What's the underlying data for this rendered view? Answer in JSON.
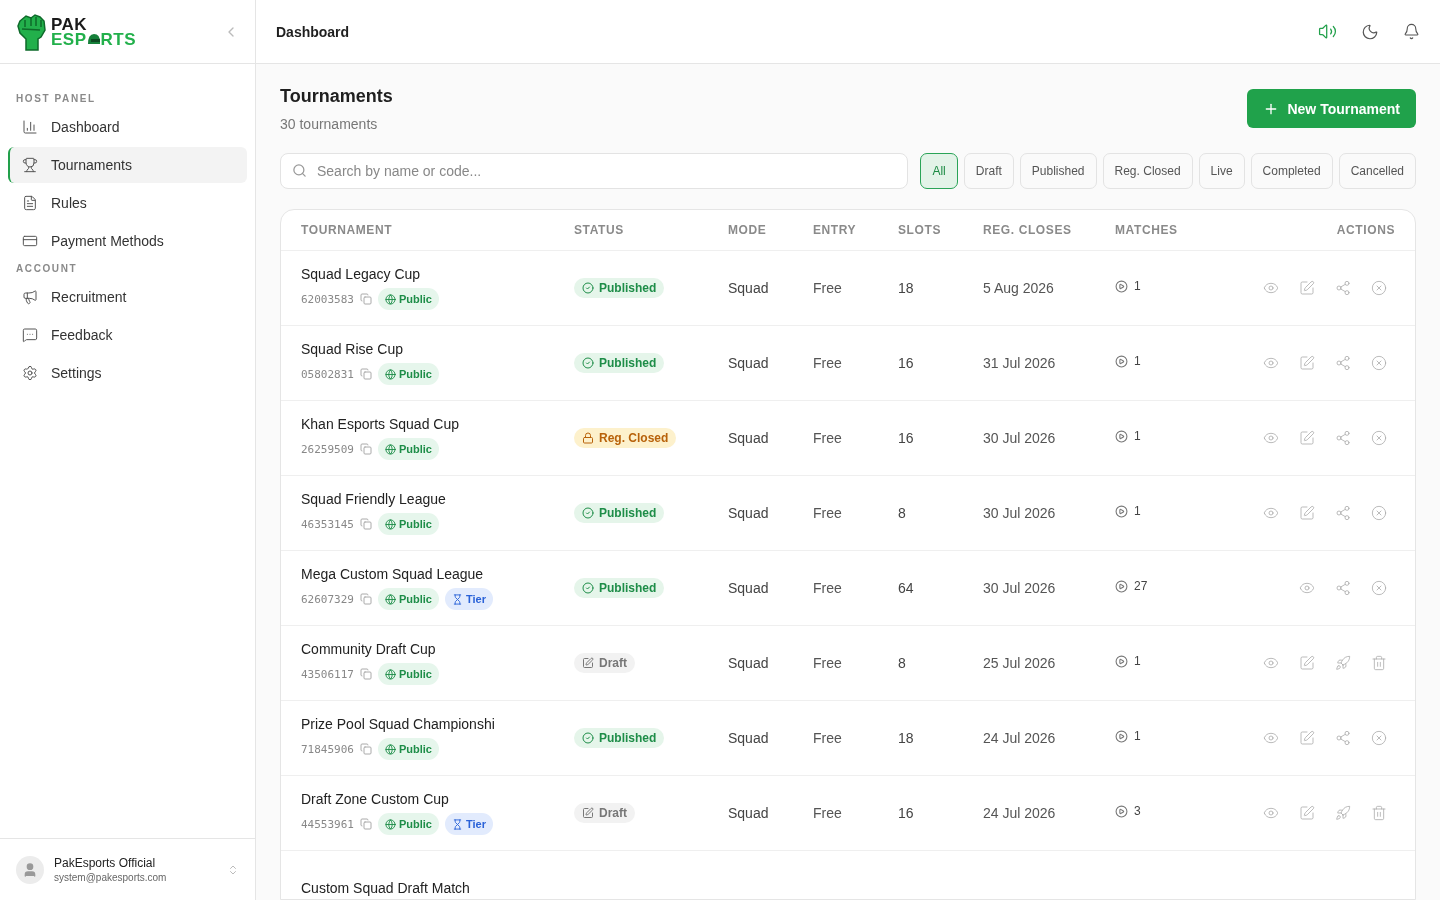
{
  "logo": {
    "line1": "PAK",
    "line2_start": "ESP",
    "line2_end": "RTS"
  },
  "sidebar": {
    "sections": [
      {
        "heading": "HOST PANEL",
        "items": [
          {
            "label": "Dashboard",
            "selected": false
          },
          {
            "label": "Tournaments",
            "selected": true
          },
          {
            "label": "Rules",
            "selected": false
          },
          {
            "label": "Payment Methods",
            "selected": false
          }
        ]
      },
      {
        "heading": "ACCOUNT",
        "items": [
          {
            "label": "Recruitment",
            "selected": false
          },
          {
            "label": "Feedback",
            "selected": false
          },
          {
            "label": "Settings",
            "selected": false
          }
        ]
      }
    ],
    "user": {
      "name": "PakEsports Official",
      "email": "system@pakesports.com"
    }
  },
  "header": {
    "title": "Dashboard"
  },
  "page": {
    "title": "Tournaments",
    "subtitle": "30 tournaments",
    "new_button": "New Tournament"
  },
  "search": {
    "placeholder": "Search by name or code..."
  },
  "filters": [
    {
      "label": "All",
      "selected": true
    },
    {
      "label": "Draft",
      "selected": false
    },
    {
      "label": "Published",
      "selected": false
    },
    {
      "label": "Reg. Closed",
      "selected": false
    },
    {
      "label": "Live",
      "selected": false
    },
    {
      "label": "Completed",
      "selected": false
    },
    {
      "label": "Cancelled",
      "selected": false
    }
  ],
  "table": {
    "columns": [
      "TOURNAMENT",
      "STATUS",
      "MODE",
      "ENTRY",
      "SLOTS",
      "REG. CLOSES",
      "MATCHES",
      "ACTIONS"
    ],
    "rows": [
      {
        "name": "Squad Legacy Cup",
        "code": "62003583",
        "badges": [
          {
            "kind": "public",
            "label": "Public"
          }
        ],
        "status": {
          "kind": "published",
          "label": "Published"
        },
        "mode": "Squad",
        "entry": "Free",
        "slots": "18",
        "reg_closes": "5 Aug 2026",
        "matches": "1",
        "actions": [
          {
            "kind": "view"
          },
          {
            "kind": "edit"
          },
          {
            "kind": "share"
          },
          {
            "kind": "cancel"
          }
        ]
      },
      {
        "name": "Squad Rise Cup",
        "code": "05802831",
        "badges": [
          {
            "kind": "public",
            "label": "Public"
          }
        ],
        "status": {
          "kind": "published",
          "label": "Published"
        },
        "mode": "Squad",
        "entry": "Free",
        "slots": "16",
        "reg_closes": "31 Jul 2026",
        "matches": "1",
        "actions": [
          {
            "kind": "view"
          },
          {
            "kind": "edit"
          },
          {
            "kind": "share"
          },
          {
            "kind": "cancel"
          }
        ]
      },
      {
        "name": "Khan Esports Squad Cup",
        "code": "26259509",
        "badges": [
          {
            "kind": "public",
            "label": "Public"
          }
        ],
        "status": {
          "kind": "reg_closed",
          "label": "Reg. Closed"
        },
        "mode": "Squad",
        "entry": "Free",
        "slots": "16",
        "reg_closes": "30 Jul 2026",
        "matches": "1",
        "actions": [
          {
            "kind": "view"
          },
          {
            "kind": "edit"
          },
          {
            "kind": "share"
          },
          {
            "kind": "cancel"
          }
        ]
      },
      {
        "name": "Squad Friendly League",
        "code": "46353145",
        "badges": [
          {
            "kind": "public",
            "label": "Public"
          }
        ],
        "status": {
          "kind": "published",
          "label": "Published"
        },
        "mode": "Squad",
        "entry": "Free",
        "slots": "8",
        "reg_closes": "30 Jul 2026",
        "matches": "1",
        "actions": [
          {
            "kind": "view"
          },
          {
            "kind": "edit"
          },
          {
            "kind": "share"
          },
          {
            "kind": "cancel"
          }
        ]
      },
      {
        "name": "Mega Custom Squad League",
        "code": "62607329",
        "badges": [
          {
            "kind": "public",
            "label": "Public"
          },
          {
            "kind": "tier",
            "label": "Tier"
          }
        ],
        "status": {
          "kind": "published",
          "label": "Published"
        },
        "mode": "Squad",
        "entry": "Free",
        "slots": "64",
        "reg_closes": "30 Jul 2026",
        "matches": "27",
        "actions": [
          {
            "kind": "view"
          },
          {
            "kind": "share"
          },
          {
            "kind": "cancel"
          }
        ]
      },
      {
        "name": "Community Draft Cup",
        "code": "43506117",
        "badges": [
          {
            "kind": "public",
            "label": "Public"
          }
        ],
        "status": {
          "kind": "draft",
          "label": "Draft"
        },
        "mode": "Squad",
        "entry": "Free",
        "slots": "8",
        "reg_closes": "25 Jul 2026",
        "matches": "1",
        "actions": [
          {
            "kind": "view"
          },
          {
            "kind": "edit"
          },
          {
            "kind": "launch"
          },
          {
            "kind": "delete"
          }
        ]
      },
      {
        "name": "Prize Pool Squad Championshi",
        "code": "71845906",
        "badges": [
          {
            "kind": "public",
            "label": "Public"
          }
        ],
        "status": {
          "kind": "published",
          "label": "Published"
        },
        "mode": "Squad",
        "entry": "Free",
        "slots": "18",
        "reg_closes": "24 Jul 2026",
        "matches": "1",
        "actions": [
          {
            "kind": "view"
          },
          {
            "kind": "edit"
          },
          {
            "kind": "share"
          },
          {
            "kind": "cancel"
          }
        ]
      },
      {
        "name": "Draft Zone Custom Cup",
        "code": "44553961",
        "badges": [
          {
            "kind": "public",
            "label": "Public"
          },
          {
            "kind": "tier",
            "label": "Tier"
          }
        ],
        "status": {
          "kind": "draft",
          "label": "Draft"
        },
        "mode": "Squad",
        "entry": "Free",
        "slots": "16",
        "reg_closes": "24 Jul 2026",
        "matches": "3",
        "actions": [
          {
            "kind": "view"
          },
          {
            "kind": "edit"
          },
          {
            "kind": "launch"
          },
          {
            "kind": "delete"
          }
        ]
      },
      {
        "name": "Custom Squad Draft Match"
      }
    ]
  }
}
